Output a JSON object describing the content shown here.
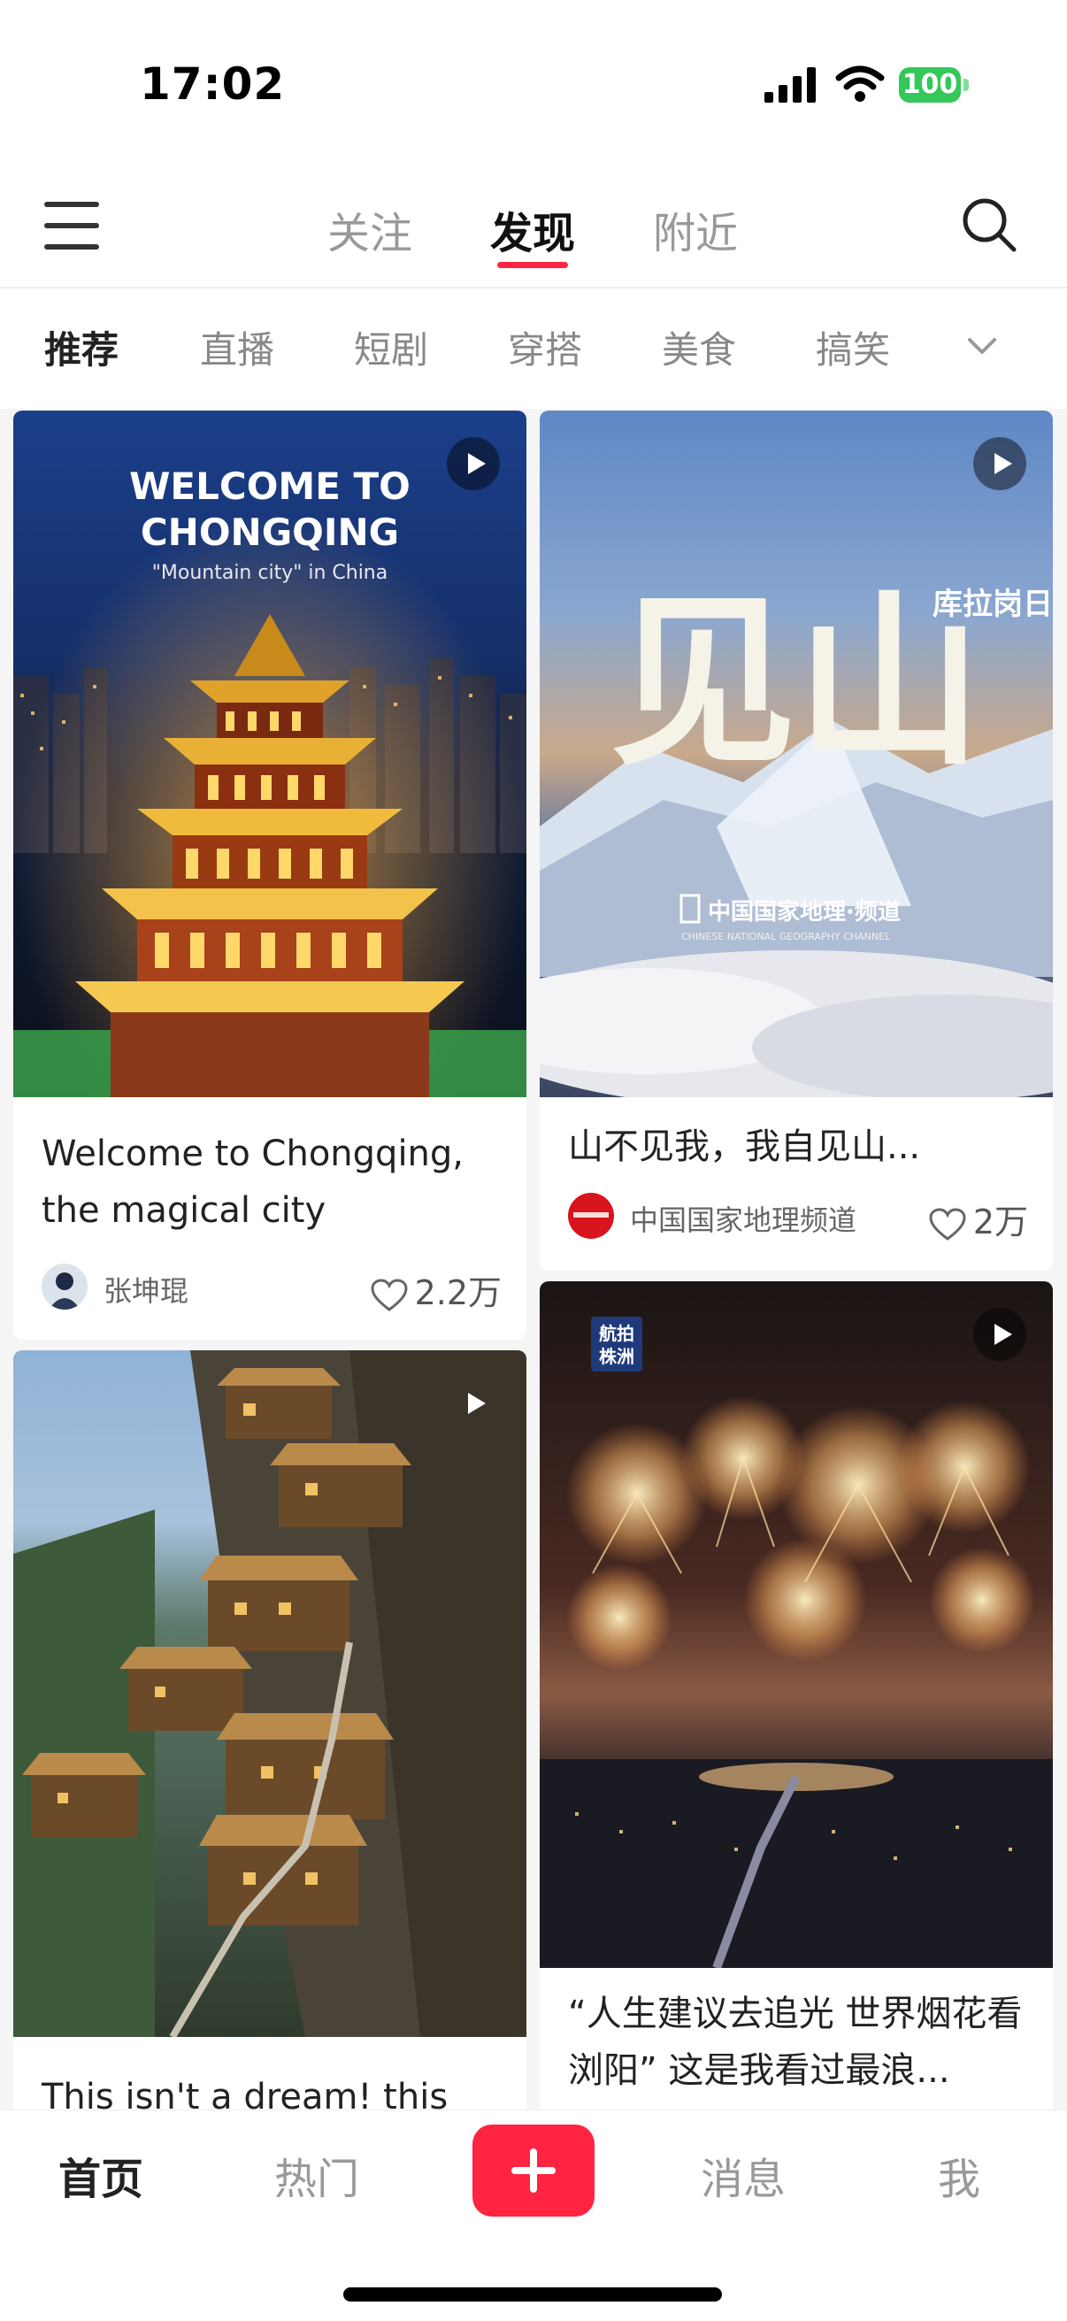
{
  "status_bar": {
    "time": "17:02",
    "battery": "100"
  },
  "top_nav": {
    "tabs": [
      {
        "label": "关注"
      },
      {
        "label": "发现"
      },
      {
        "label": "附近"
      }
    ],
    "active_tab": "发现"
  },
  "categories": {
    "items": [
      "推荐",
      "直播",
      "短剧",
      "穿搭",
      "美食",
      "搞笑"
    ],
    "active": "推荐"
  },
  "feed": {
    "cards": [
      {
        "cover_title": "WELCOME TO",
        "cover_title2": "CHONGQING",
        "cover_subtitle": "\"Mountain city\" in China",
        "title": "Welcome to Chongqing, the magical city",
        "author": "张坤琨",
        "likes": "2.2万",
        "is_video": true
      },
      {
        "cover_title": "见山",
        "cover_side": "库拉岗日",
        "cover_channel": "中国国家地理·频道",
        "cover_channel_en": "CHINESE NATIONAL GEOGRAPHY CHANNEL",
        "title": "山不见我，我自见山...",
        "author": "中国国家地理频道",
        "likes": "2万",
        "is_video": true
      },
      {
        "title": "This isn't a dream!  this",
        "is_video": true
      },
      {
        "cover_badge_line1": "航拍",
        "cover_badge_line2": "株洲",
        "title": "“人生建议去追光 世界烟花看浏阳” 这是我看过最浪...",
        "is_video": true
      }
    ]
  },
  "tab_bar": {
    "items": [
      "首页",
      "热门",
      "消息",
      "我"
    ],
    "active": "首页"
  },
  "colors": {
    "accent": "#ff2442",
    "battery": "#34c759"
  }
}
